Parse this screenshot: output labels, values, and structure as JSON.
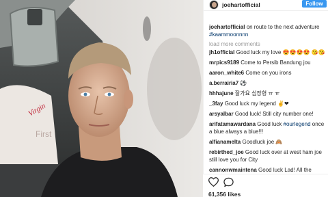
{
  "colors": {
    "follow": "#3897f0",
    "hashtag": "#003569",
    "muted": "#999999"
  },
  "photo": {
    "seat_text": "First",
    "brand_script": "Virgin"
  },
  "header": {
    "username": "joehartofficial",
    "follow_label": "Follow"
  },
  "caption": {
    "user": "joehartofficial",
    "text_before": "on route to the next adventure ",
    "hashtag": "#kaammoonnnn"
  },
  "load_more": "load more comments",
  "comments": [
    {
      "user": "jh1official",
      "text": "Good luck my love 😍😍😍😍 😘😘"
    },
    {
      "user": "mrpics9189",
      "text": "Come to Persib Bandung jou"
    },
    {
      "user": "aaron_white6",
      "text": "Come on you irons"
    },
    {
      "user": "a.berrairia7",
      "text": "⚽"
    },
    {
      "user": "hhhajune",
      "text": "잘가요 심장형 ㅠ ㅠ"
    },
    {
      "user": "_3fay",
      "text": "Good luck my legend ✌❤"
    },
    {
      "user": "arsyalbar",
      "text": "Good luck! Still city number one!"
    },
    {
      "user": "arifatamawardana",
      "text": "Good luck",
      "hashtag": "#ourlegend",
      "text2": " once a blue always a blue!!!"
    },
    {
      "user": "alfianamelta",
      "text": "Goodluck joe 🙈"
    },
    {
      "user": "rebirthed_joe",
      "text": "Good luck over at west ham joe still love you for City"
    },
    {
      "user": "cannonwmaintena",
      "text": "Good luck Lad! All the"
    }
  ],
  "actions": {
    "heart_icon": "heart-outline",
    "comment_icon": "speech-bubble-outline",
    "likes": "61,356 likes"
  }
}
